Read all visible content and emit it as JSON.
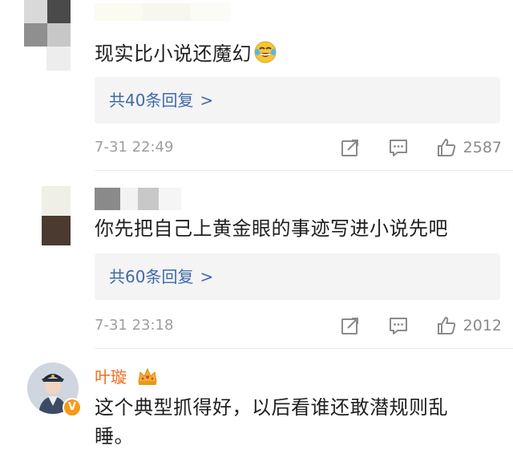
{
  "comments": [
    {
      "text": "现实比小说还魔幻",
      "emoji": "laugh-cry-emoji",
      "reply_label": "共40条回复",
      "reply_chevron": ">",
      "time": "7-31 22:49",
      "likes": "2587"
    },
    {
      "text": "你先把自己上黄金眼的事迹写进小说先吧",
      "reply_label": "共60条回复",
      "reply_chevron": ">",
      "time": "7-31 23:18",
      "likes": "2012"
    },
    {
      "username": "叶璇",
      "text_line1": "这个典型抓得好，以后看谁还敢潜规则乱",
      "text_line2": "睡。",
      "badge": "V"
    }
  ],
  "colors": {
    "reply_link": "#3f6aa6",
    "username": "#f26b1d",
    "meta_gray": "#9e9e9e",
    "verified_badge": "#f79a19"
  },
  "icons": [
    "share-icon",
    "comment-icon",
    "like-icon",
    "crown-icon"
  ]
}
